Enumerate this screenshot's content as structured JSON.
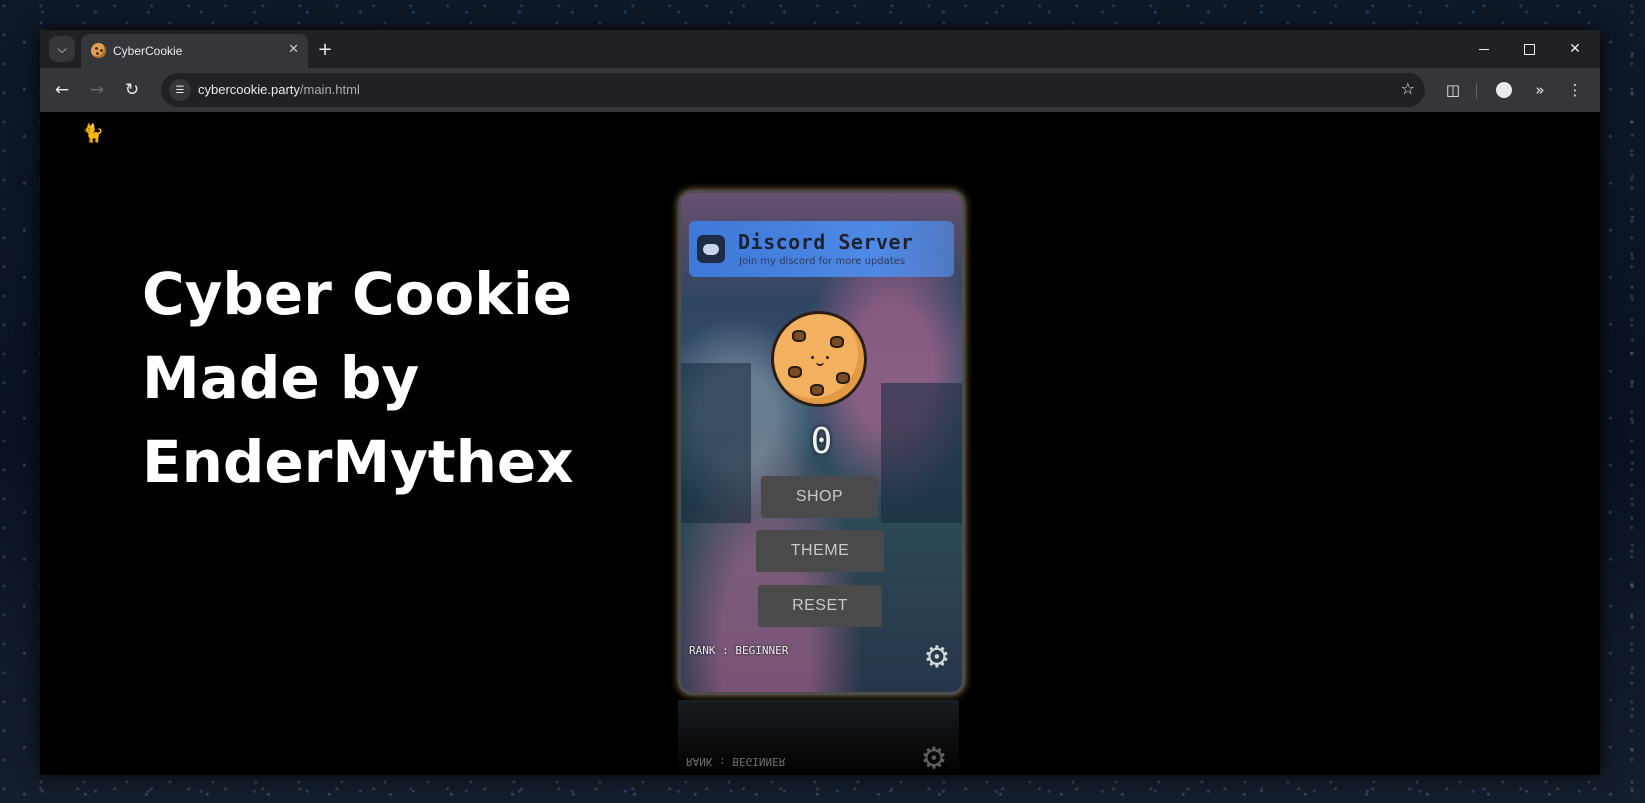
{
  "browser": {
    "tab_title": "CyberCookie",
    "tab_close_icon": "close-icon",
    "url_host": "cybercookie.party",
    "url_path": "/main.html",
    "icons": {
      "tab_search": "chevron-down-icon",
      "new_tab": "plus-icon",
      "back": "arrow-left-icon",
      "forward": "arrow-right-icon",
      "reload": "reload-icon",
      "site_info": "tune-icon",
      "bookmark": "star-icon",
      "extensions": "puzzle-icon",
      "profile": "person-icon",
      "more_extensions": "double-chevron-icon",
      "menu": "kebab-menu-icon",
      "minimize": "minimize-icon",
      "maximize": "maximize-icon",
      "close_window": "close-icon"
    }
  },
  "page": {
    "headline": [
      "Cyber Cookie",
      "Made by",
      "EnderMythex"
    ],
    "discord": {
      "title": "Discord Server",
      "subtitle": "Join my discord for more updates"
    },
    "cookie_count": "0",
    "buttons": {
      "shop": "SHOP",
      "theme": "THEME",
      "reset": "RESET"
    },
    "rank": "RANK : BEGINNER",
    "reflection_rank": "RANK : BEGINNER"
  },
  "colors": {
    "cookie": "#f3b160",
    "discord_banner": "#4f89e6",
    "button_bg": "#4a4a4a",
    "button_text": "#c9c9c9"
  }
}
